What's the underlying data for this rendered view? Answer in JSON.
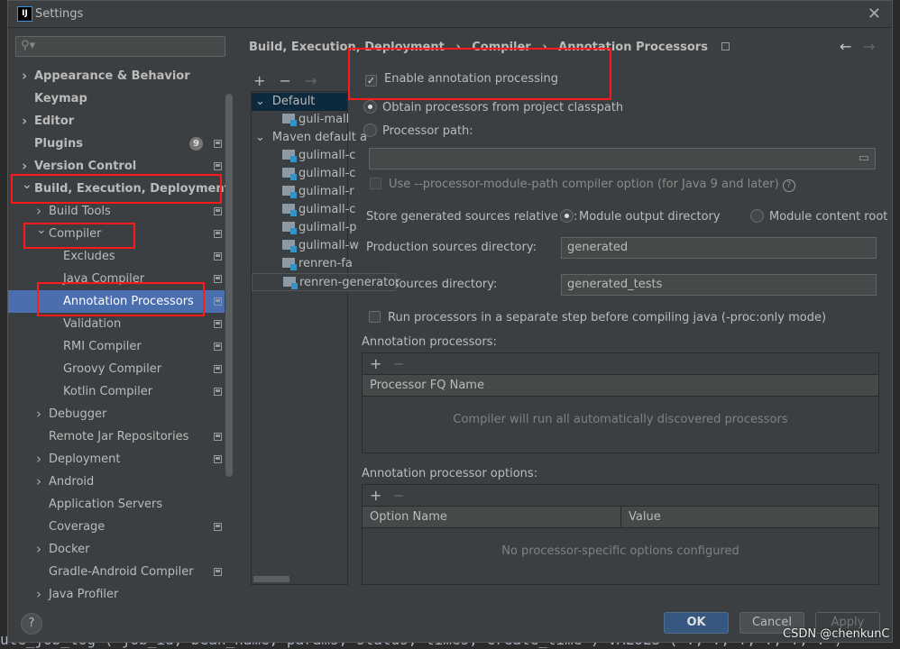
{
  "background_code": "ute_job_log ( job_id, bean_name, params, status, times, create_time ) VALUES ( ?, ?, ?, ?, ?, ? )",
  "watermark": "CSDN @chenkunC",
  "window": {
    "title": "Settings",
    "logo": "IJ"
  },
  "sidebar": {
    "search_placeholder": "",
    "items": [
      {
        "label": "Appearance & Behavior",
        "level": 0,
        "bold": true,
        "chevron": true
      },
      {
        "label": "Keymap",
        "level": 0,
        "bold": true
      },
      {
        "label": "Editor",
        "level": 0,
        "bold": true,
        "chevron": true
      },
      {
        "label": "Plugins",
        "level": 0,
        "bold": true,
        "badge": "9",
        "page": true
      },
      {
        "label": "Version Control",
        "level": 0,
        "bold": true,
        "chevron": true,
        "page": true
      },
      {
        "label": "Build, Execution, Deployment",
        "level": 0,
        "bold": true,
        "expanded": true
      },
      {
        "label": "Build Tools",
        "level": 1,
        "chevron": true,
        "page": true
      },
      {
        "label": "Compiler",
        "level": 1,
        "expanded": true,
        "page": true
      },
      {
        "label": "Excludes",
        "level": 2,
        "page": true
      },
      {
        "label": "Java Compiler",
        "level": 2,
        "page": true
      },
      {
        "label": "Annotation Processors",
        "level": 2,
        "page": true,
        "selected": true
      },
      {
        "label": "Validation",
        "level": 2,
        "page": true
      },
      {
        "label": "RMI Compiler",
        "level": 2,
        "page": true
      },
      {
        "label": "Groovy Compiler",
        "level": 2,
        "page": true
      },
      {
        "label": "Kotlin Compiler",
        "level": 2,
        "page": true
      },
      {
        "label": "Debugger",
        "level": 1,
        "chevron": true
      },
      {
        "label": "Remote Jar Repositories",
        "level": 1,
        "page": true
      },
      {
        "label": "Deployment",
        "level": 1,
        "chevron": true,
        "page": true
      },
      {
        "label": "Android",
        "level": 1,
        "chevron": true
      },
      {
        "label": "Application Servers",
        "level": 1
      },
      {
        "label": "Coverage",
        "level": 1,
        "page": true
      },
      {
        "label": "Docker",
        "level": 1,
        "chevron": true
      },
      {
        "label": "Gradle-Android Compiler",
        "level": 1,
        "page": true
      },
      {
        "label": "Java Profiler",
        "level": 1,
        "chevron": true
      }
    ]
  },
  "breadcrumb": {
    "items": [
      "Build, Execution, Deployment",
      "Compiler",
      "Annotation Processors"
    ],
    "sep": "›"
  },
  "profiles": {
    "toolbar": [
      "+",
      "−",
      "→"
    ],
    "items": [
      {
        "label": "Default",
        "level": 0,
        "expanded": true,
        "selected": true
      },
      {
        "label": "guli-mall",
        "level": 1
      },
      {
        "label": "Maven default a",
        "level": 0,
        "expanded": true
      },
      {
        "label": "gulimall-c",
        "level": 1
      },
      {
        "label": "gulimall-c",
        "level": 1
      },
      {
        "label": "gulimall-r",
        "level": 1
      },
      {
        "label": "gulimall-c",
        "level": 1
      },
      {
        "label": "gulimall-p",
        "level": 1
      },
      {
        "label": "gulimall-w",
        "level": 1
      },
      {
        "label": "renren-fa",
        "level": 1
      },
      {
        "label": "renren-generator",
        "level": 1,
        "tooltip": true
      }
    ]
  },
  "form": {
    "enable_label": "Enable annotation processing",
    "enable_checked": true,
    "obtain_label": "Obtain processors from project classpath",
    "path_label": "Processor path:",
    "path_value": "",
    "module_path_label": "Use --processor-module-path compiler option (for Java 9 and later)",
    "store_label": "Store generated sources relative to:",
    "module_output_label": "Module output directory",
    "module_content_label": "Module content root",
    "prod_label": "Production sources directory:",
    "prod_value": "generated",
    "test_label": "Test sources directory:",
    "test_value": "generated_tests",
    "separate_label": "Run processors in a separate step before compiling java (-proc:only mode)",
    "processors_label": "Annotation processors:",
    "processors_col": "Processor FQ Name",
    "processors_empty": "Compiler will run all automatically discovered processors",
    "options_label": "Annotation processor options:",
    "options_col1": "Option Name",
    "options_col2": "Value",
    "options_empty": "No processor-specific options configured"
  },
  "footer": {
    "help": "?",
    "ok": "OK",
    "cancel": "Cancel",
    "apply": "Apply"
  },
  "colors": {
    "selection": "#4b6eaf",
    "highlight": "#ff1a1a",
    "ok": "#365880"
  }
}
